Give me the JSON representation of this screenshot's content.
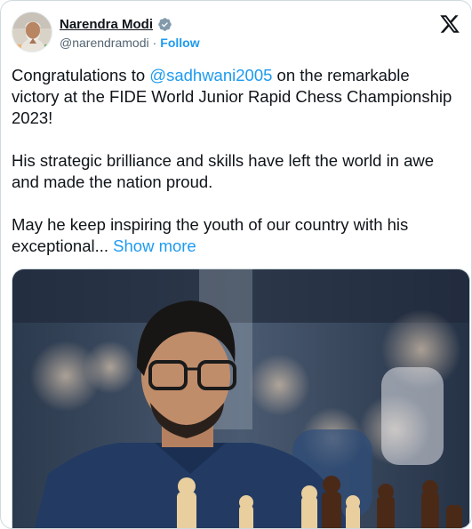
{
  "author": {
    "display_name": "Narendra Modi",
    "handle": "@narendramodi",
    "separator": "·",
    "follow_label": "Follow",
    "verified_icon": "verified-badge-icon",
    "avatar_icon": "profile-avatar"
  },
  "brand": {
    "logo_icon": "x-logo-icon"
  },
  "post": {
    "p1_prefix": "Congratulations to ",
    "mention": "@sadhwani2005",
    "p1_suffix": " on the remarkable victory at the FIDE World Junior Rapid Chess Championship 2023!",
    "p2": "His strategic brilliance and skills have left the world in awe and made the nation proud.",
    "p3": "May he keep inspiring the youth of our country with his exceptional...",
    "show_more": "Show more"
  },
  "media": {
    "description_icon": "chess-player-photo"
  },
  "colors": {
    "link": "#1d9bf0",
    "text": "#0f1419",
    "muted": "#536471",
    "border": "#cfd9de"
  }
}
